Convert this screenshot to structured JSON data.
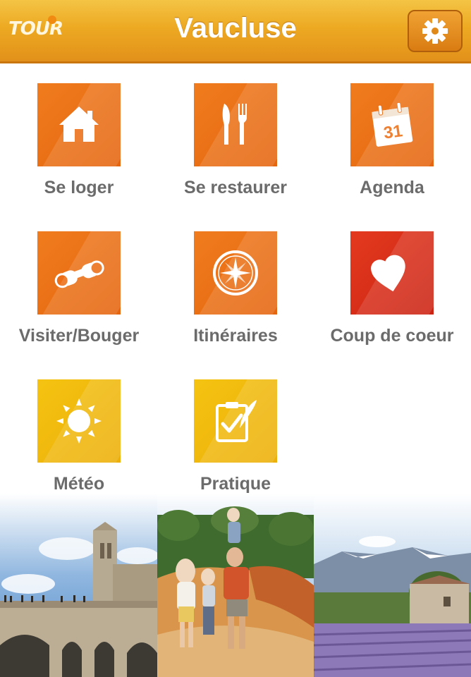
{
  "header": {
    "logo_text": "TOUR",
    "title": "Vaucluse",
    "settings_icon": "gear-icon"
  },
  "menu": [
    {
      "label": "Se loger",
      "icon": "house-icon",
      "color": "#ec6f17"
    },
    {
      "label": "Se restaurer",
      "icon": "utensils-icon",
      "color": "#ec6f17"
    },
    {
      "label": "Agenda",
      "icon": "calendar-icon",
      "color": "#ec6f17",
      "icon_text": "31"
    },
    {
      "label": "Visiter/Bouger",
      "icon": "binoculars-icon",
      "color": "#ec6f17"
    },
    {
      "label": "Itinéraires",
      "icon": "compass-icon",
      "color": "#ec6f17"
    },
    {
      "label": "Coup de coeur",
      "icon": "heart-icon",
      "color": "#d62d18"
    },
    {
      "label": "Météo",
      "icon": "sun-icon",
      "color": "#f1b90d"
    },
    {
      "label": "Pratique",
      "icon": "clipboard-check-icon",
      "color": "#f1b90d"
    }
  ],
  "photos": [
    {
      "name": "pont-avignon-photo"
    },
    {
      "name": "family-ochre-trail-photo"
    },
    {
      "name": "lavender-field-photo"
    }
  ]
}
